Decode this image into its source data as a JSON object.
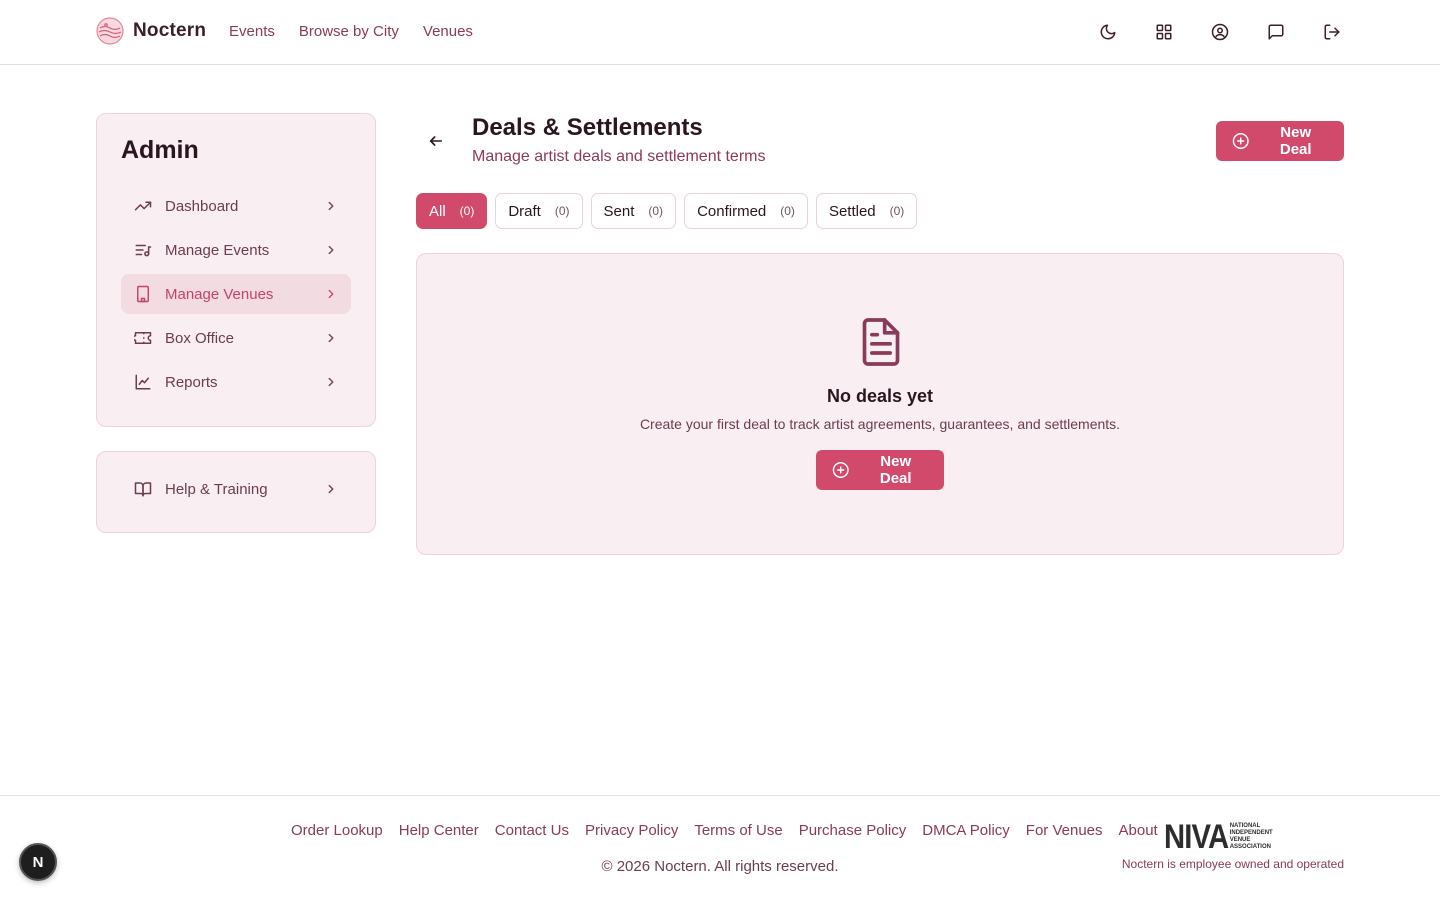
{
  "header": {
    "brand": "Noctern",
    "nav": [
      "Events",
      "Browse by City",
      "Venues"
    ],
    "icons": [
      "moon-icon",
      "grid-icon",
      "user-circle-icon",
      "chat-icon",
      "logout-icon"
    ]
  },
  "sidebar": {
    "title": "Admin",
    "items": [
      {
        "label": "Dashboard",
        "icon": "trending-up-icon",
        "active": false
      },
      {
        "label": "Manage Events",
        "icon": "list-music-icon",
        "active": false
      },
      {
        "label": "Manage Venues",
        "icon": "building-icon",
        "active": true
      },
      {
        "label": "Box Office",
        "icon": "ticket-icon",
        "active": false
      },
      {
        "label": "Reports",
        "icon": "line-chart-icon",
        "active": false
      }
    ],
    "help": {
      "label": "Help & Training",
      "icon": "book-open-icon"
    }
  },
  "main": {
    "title": "Deals & Settlements",
    "subtitle": "Manage artist deals and settlement terms",
    "new_deal_label": "New Deal",
    "tabs": [
      {
        "label": "All",
        "count": "(0)",
        "active": true
      },
      {
        "label": "Draft",
        "count": "(0)",
        "active": false
      },
      {
        "label": "Sent",
        "count": "(0)",
        "active": false
      },
      {
        "label": "Confirmed",
        "count": "(0)",
        "active": false
      },
      {
        "label": "Settled",
        "count": "(0)",
        "active": false
      }
    ],
    "empty": {
      "title": "No deals yet",
      "description": "Create your first deal to track artist agreements, guarantees, and settlements.",
      "button_label": "New Deal"
    }
  },
  "footer": {
    "links": [
      "Order Lookup",
      "Help Center",
      "Contact Us",
      "Privacy Policy",
      "Terms of Use",
      "Purchase Policy",
      "DMCA Policy",
      "For Venues",
      "About"
    ],
    "copyright": "© 2026 Noctern. All rights reserved.",
    "niva_mark": "NIVA",
    "niva_text": [
      "NATIONAL",
      "INDEPENDENT",
      "VENUE",
      "ASSOCIATION"
    ],
    "tagline": "Noctern is employee owned and operated"
  },
  "fab_label": "N",
  "colors": {
    "accent": "#d14a6c",
    "card_bg": "#f9eef1",
    "link": "#8a3a5a"
  }
}
